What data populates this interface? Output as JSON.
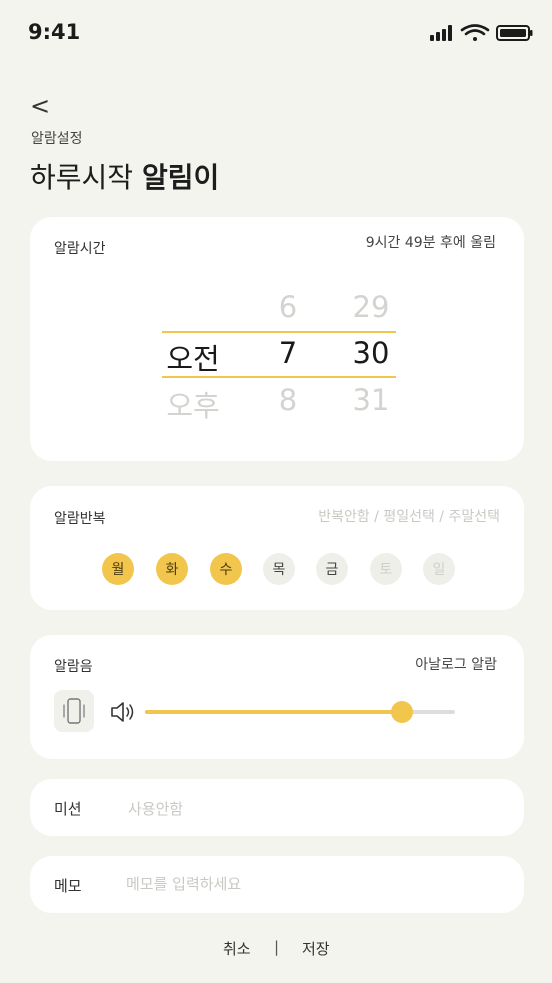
{
  "status": {
    "time": "9:41"
  },
  "header": {
    "back": "<",
    "subtitle": "알람설정",
    "title_prefix": "하루시작 ",
    "title_bold": "알림이"
  },
  "alarm_time": {
    "label": "알람시간",
    "remaining": "9시간 49분 후에 울림",
    "ampm": {
      "selected": "오전",
      "next": "오후"
    },
    "hours": {
      "prev": "6",
      "selected": "7",
      "next": "8"
    },
    "minutes": {
      "prev": "29",
      "selected": "30",
      "next": "31"
    }
  },
  "repeat": {
    "label": "알람반복",
    "options": "반복안함 / 평일선택 / 주말선택",
    "days": [
      {
        "label": "월",
        "state": "on"
      },
      {
        "label": "화",
        "state": "on"
      },
      {
        "label": "수",
        "state": "on"
      },
      {
        "label": "목",
        "state": "normal"
      },
      {
        "label": "금",
        "state": "normal"
      },
      {
        "label": "토",
        "state": "off"
      },
      {
        "label": "일",
        "state": "off"
      }
    ]
  },
  "sound": {
    "label": "알람음",
    "name": "아날로그 알람",
    "volume": 0.83
  },
  "mission": {
    "label": "미션",
    "value": "사용안함"
  },
  "memo": {
    "label": "메모",
    "placeholder": "메모를 입력하세요"
  },
  "footer": {
    "cancel": "취소",
    "divider": "|",
    "save": "저장"
  },
  "colors": {
    "accent": "#f2c64c",
    "background": "#f4f4ef",
    "card": "#ffffff"
  }
}
